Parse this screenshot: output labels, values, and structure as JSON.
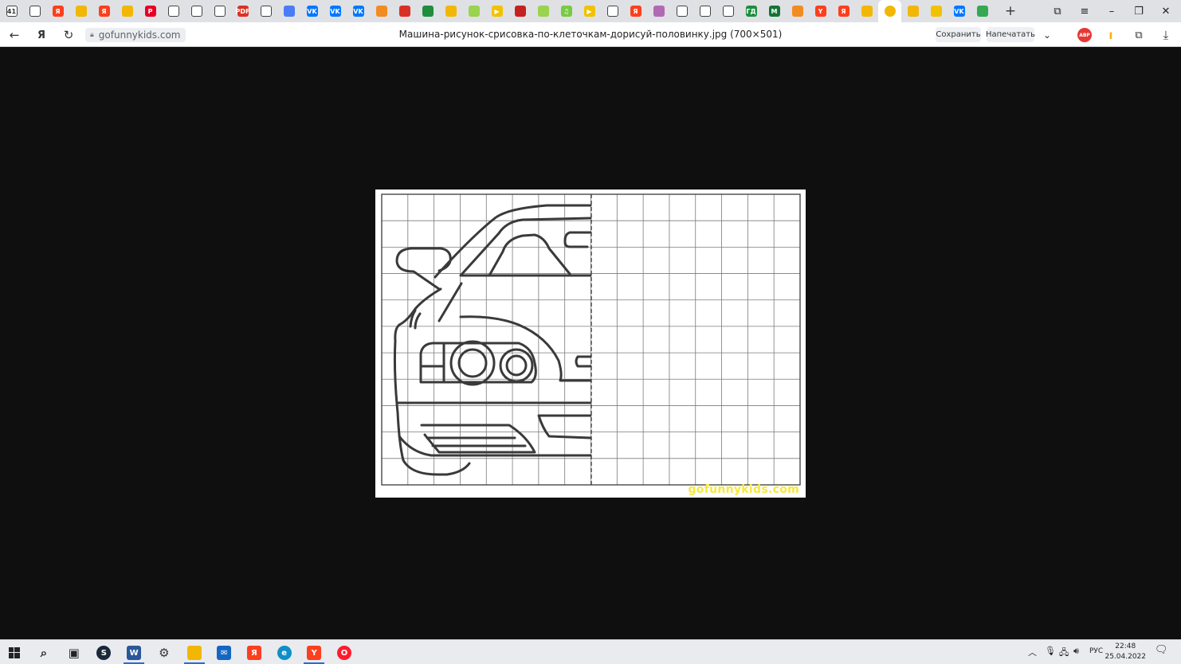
{
  "colors": {
    "tabbar_bg": "#dfe1e5",
    "active_tab_bg": "#ffffff",
    "page_bg": "#0f0f0f",
    "watermark": "#f7e73c",
    "drawing_line": "#3a3a3a",
    "grid": "#777777"
  },
  "tabs": [
    {
      "icon": "home-counter-icon",
      "text": "41",
      "color": "#ffffff"
    },
    {
      "icon": "new-folder-icon",
      "text": "",
      "color": "#ffffff"
    },
    {
      "icon": "yandex-icon",
      "text": "Я",
      "color": "#fc3f1d"
    },
    {
      "icon": "image-icon",
      "text": "",
      "color": "#f2b705"
    },
    {
      "icon": "yandex-icon",
      "text": "Я",
      "color": "#fc3f1d"
    },
    {
      "icon": "image-icon",
      "text": "",
      "color": "#f2b705"
    },
    {
      "icon": "pinterest-icon",
      "text": "P",
      "color": "#e60023"
    },
    {
      "icon": "document-icon",
      "text": "",
      "color": "#ffffff"
    },
    {
      "icon": "document-icon",
      "text": "",
      "color": "#ffffff"
    },
    {
      "icon": "document-icon",
      "text": "",
      "color": "#ffffff"
    },
    {
      "icon": "pdf-icon",
      "text": "PDF",
      "color": "#d93025"
    },
    {
      "icon": "bird-icon",
      "text": "",
      "color": "#ffffff"
    },
    {
      "icon": "triangle-icon",
      "text": "",
      "color": "#4a7cf7"
    },
    {
      "icon": "vk-icon",
      "text": "VK",
      "color": "#0077ff"
    },
    {
      "icon": "vk-icon",
      "text": "VK",
      "color": "#0077ff"
    },
    {
      "icon": "vk-icon",
      "text": "VK",
      "color": "#0077ff"
    },
    {
      "icon": "flag-icon",
      "text": "",
      "color": "#f28b22"
    },
    {
      "icon": "rosbank-icon",
      "text": "",
      "color": "#d93025"
    },
    {
      "icon": "green-square-icon",
      "text": "",
      "color": "#1e8e3e"
    },
    {
      "icon": "image-icon",
      "text": "",
      "color": "#f2b705"
    },
    {
      "icon": "dot-icon",
      "text": "",
      "color": "#9ad34d"
    },
    {
      "icon": "play-icon",
      "text": "▶",
      "color": "#f2c200"
    },
    {
      "icon": "red-book-icon",
      "text": "",
      "color": "#c5221f"
    },
    {
      "icon": "dot-icon",
      "text": "",
      "color": "#9ad34d"
    },
    {
      "icon": "music-icon",
      "text": "♫",
      "color": "#7ac943"
    },
    {
      "icon": "play-icon",
      "text": "▶",
      "color": "#f2c200"
    },
    {
      "icon": "document-icon",
      "text": "",
      "color": "#ffffff"
    },
    {
      "icon": "yandex-icon",
      "text": "Я",
      "color": "#fc3f1d"
    },
    {
      "icon": "colorwheel-icon",
      "text": "",
      "color": "#b06ab3"
    },
    {
      "icon": "document-icon",
      "text": "",
      "color": "#ffffff"
    },
    {
      "icon": "document-icon",
      "text": "",
      "color": "#ffffff"
    },
    {
      "icon": "document-icon",
      "text": "",
      "color": "#ffffff"
    },
    {
      "icon": "gd-icon",
      "text": "ГД",
      "color": "#1e8e3e"
    },
    {
      "icon": "m-icon",
      "text": "M",
      "color": "#137333"
    },
    {
      "icon": "ok-icon",
      "text": "",
      "color": "#f28b22"
    },
    {
      "icon": "yandex-y-icon",
      "text": "Y",
      "color": "#fc3f1d"
    },
    {
      "icon": "yandex-icon",
      "text": "Я",
      "color": "#fc3f1d"
    },
    {
      "icon": "image-icon",
      "text": "",
      "color": "#f2b705"
    },
    {
      "icon": "sun-icon",
      "text": "",
      "color": "#f2b705",
      "active": true
    },
    {
      "icon": "image-icon",
      "text": "",
      "color": "#f2b705"
    },
    {
      "icon": "wave-icon",
      "text": "",
      "color": "#f2c200"
    },
    {
      "icon": "vk-icon",
      "text": "VK",
      "color": "#0077ff"
    },
    {
      "icon": "puzzle-icon",
      "text": "",
      "color": "#34a853"
    }
  ],
  "address_bar": {
    "url": "gofunnykids.com",
    "page_title": "Машина-рисунок-срисовка-по-клеточкам-дорисуй-половинку.jpg (700×501)",
    "save_label": "Сохранить",
    "print_label": "Напечатать",
    "adblock_label": "ABP"
  },
  "image": {
    "watermark": "gofunnykids.com",
    "grid_cols": 16,
    "grid_rows": 11
  },
  "taskbar": {
    "apps": [
      {
        "name": "search-icon",
        "text": "⌕",
        "color": "#222222"
      },
      {
        "name": "task-view-icon",
        "text": "▣",
        "color": "#222222"
      },
      {
        "name": "steam-icon",
        "text": "S",
        "color": "#1b2838"
      },
      {
        "name": "word-icon",
        "text": "W",
        "color": "#2b579a",
        "active": true
      },
      {
        "name": "tank-icon",
        "text": "⚙",
        "color": "#333333"
      },
      {
        "name": "file-explorer-icon",
        "text": "",
        "color": "#f2b705",
        "active": true
      },
      {
        "name": "mail-icon",
        "text": "✉",
        "color": "#1466c2"
      },
      {
        "name": "yandex-icon",
        "text": "Я",
        "color": "#fc3f1d"
      },
      {
        "name": "edge-icon",
        "text": "e",
        "color": "#0f8fc7"
      },
      {
        "name": "yandex-browser-icon",
        "text": "Y",
        "color": "#fc3f1d",
        "active": true
      },
      {
        "name": "opera-icon",
        "text": "O",
        "color": "#ff1b2d"
      }
    ],
    "language": "РУС",
    "time": "22:48",
    "date": "25.04.2022"
  }
}
